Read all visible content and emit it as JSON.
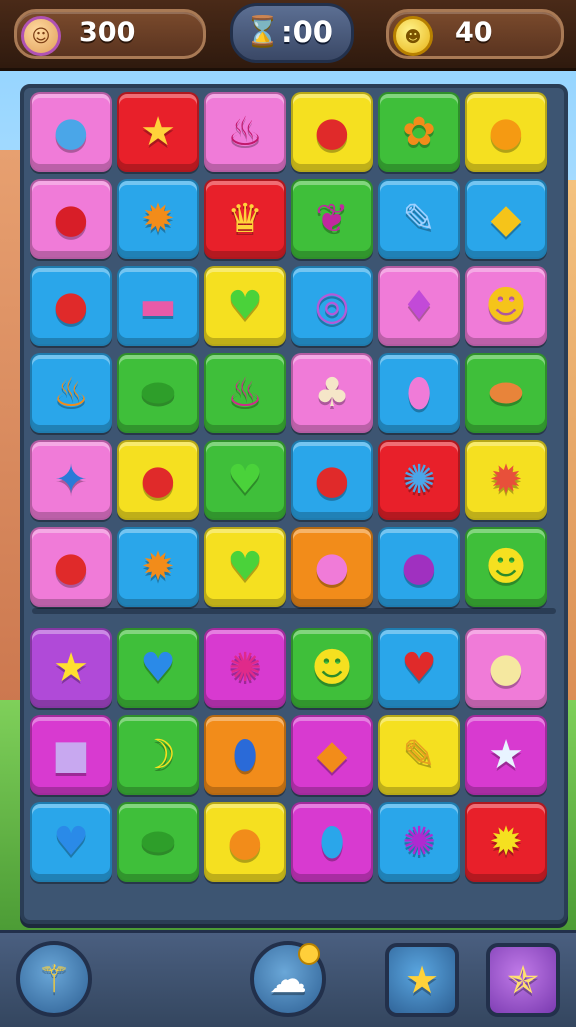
{
  "hud": {
    "score": "300",
    "timer": ":00",
    "coins": "40",
    "avatar_icon": "☺",
    "coin_icon": "☻",
    "timer_icon": "⌛"
  },
  "board": {
    "columns": 6,
    "rows": 9,
    "tiles": [
      {
        "color": "#f07bd8",
        "glyph": "●",
        "glyph_color": "#4aa6e8",
        "name": "blue-candy"
      },
      {
        "color": "#e8202a",
        "glyph": "★",
        "glyph_color": "#ffd23a",
        "name": "star-face"
      },
      {
        "color": "#f07bd8",
        "glyph": "♨",
        "glyph_color": "#c2186b",
        "name": "cupcake"
      },
      {
        "color": "#f5e020",
        "glyph": "●",
        "glyph_color": "#e02a2a",
        "name": "apple"
      },
      {
        "color": "#3fbf3a",
        "glyph": "✿",
        "glyph_color": "#f28c1a",
        "name": "flower"
      },
      {
        "color": "#f5e020",
        "glyph": "●",
        "glyph_color": "#f59a12",
        "name": "orange"
      },
      {
        "color": "#f07bd8",
        "glyph": "●",
        "glyph_color": "#d81e28",
        "name": "apple"
      },
      {
        "color": "#2aa6ea",
        "glyph": "✹",
        "glyph_color": "#f28c1a",
        "name": "sun-face"
      },
      {
        "color": "#e8202a",
        "glyph": "♛",
        "glyph_color": "#ffd23a",
        "name": "crown-candy"
      },
      {
        "color": "#3fbf3a",
        "glyph": "❦",
        "glyph_color": "#c0289e",
        "name": "grapes"
      },
      {
        "color": "#2aa6ea",
        "glyph": "✎",
        "glyph_color": "#9ed0ff",
        "name": "feather"
      },
      {
        "color": "#2aa6ea",
        "glyph": "◆",
        "glyph_color": "#f5c41a",
        "name": "pear"
      },
      {
        "color": "#2aa6ea",
        "glyph": "●",
        "glyph_color": "#e02a2a",
        "name": "apple"
      },
      {
        "color": "#2aa6ea",
        "glyph": "▬",
        "glyph_color": "#e85aa8",
        "name": "candy-stick"
      },
      {
        "color": "#f5e020",
        "glyph": "♥",
        "glyph_color": "#4ad23a",
        "name": "heart"
      },
      {
        "color": "#2aa6ea",
        "glyph": "◎",
        "glyph_color": "#b45ad8",
        "name": "donut"
      },
      {
        "color": "#f07bd8",
        "glyph": "♦",
        "glyph_color": "#c24ad8",
        "name": "leaf-candy"
      },
      {
        "color": "#f07bd8",
        "glyph": "☻",
        "glyph_color": "#f5c41a",
        "name": "lemon-face"
      },
      {
        "color": "#2aa6ea",
        "glyph": "♨",
        "glyph_color": "#f28c1a",
        "name": "carrot"
      },
      {
        "color": "#3fbf3a",
        "glyph": "⬬",
        "glyph_color": "#2e9e2a",
        "name": "pea-pod"
      },
      {
        "color": "#3fbf3a",
        "glyph": "♨",
        "glyph_color": "#d02a8a",
        "name": "pudding"
      },
      {
        "color": "#f07bd8",
        "glyph": "♣",
        "glyph_color": "#f5e6c8",
        "name": "acorn"
      },
      {
        "color": "#2aa6ea",
        "glyph": "⬮",
        "glyph_color": "#f07bd8",
        "name": "pink-blob"
      },
      {
        "color": "#3fbf3a",
        "glyph": "⬬",
        "glyph_color": "#e8843a",
        "name": "pie"
      },
      {
        "color": "#f07bd8",
        "glyph": "✦",
        "glyph_color": "#2a7ad8",
        "name": "blue-flower"
      },
      {
        "color": "#f5e020",
        "glyph": "●",
        "glyph_color": "#e02a2a",
        "name": "tomato"
      },
      {
        "color": "#3fbf3a",
        "glyph": "♥",
        "glyph_color": "#4ad23a",
        "name": "heart"
      },
      {
        "color": "#2aa6ea",
        "glyph": "●",
        "glyph_color": "#e02a2a",
        "name": "apple"
      },
      {
        "color": "#e8202a",
        "glyph": "✺",
        "glyph_color": "#4aa6e8",
        "name": "germ"
      },
      {
        "color": "#f5e020",
        "glyph": "✹",
        "glyph_color": "#e8503a",
        "name": "spiky-fruit"
      },
      {
        "color": "#f07bd8",
        "glyph": "●",
        "glyph_color": "#e02a2a",
        "name": "strawberry"
      },
      {
        "color": "#2aa6ea",
        "glyph": "✹",
        "glyph_color": "#f28c1a",
        "name": "sun-face"
      },
      {
        "color": "#f5e020",
        "glyph": "♥",
        "glyph_color": "#4ad23a",
        "name": "heart"
      },
      {
        "color": "#f28c1a",
        "glyph": "●",
        "glyph_color": "#f07bd8",
        "name": "bubble"
      },
      {
        "color": "#2aa6ea",
        "glyph": "●",
        "glyph_color": "#a030c0",
        "name": "plum"
      },
      {
        "color": "#3fbf3a",
        "glyph": "☻",
        "glyph_color": "#f5e020",
        "name": "lemon-face"
      },
      {
        "color": "#b04ad8",
        "glyph": "★",
        "glyph_color": "#ffe030",
        "name": "star-face"
      },
      {
        "color": "#3fbf3a",
        "glyph": "♥",
        "glyph_color": "#2a8ae8",
        "name": "heart"
      },
      {
        "color": "#d83ad0",
        "glyph": "✺",
        "glyph_color": "#e02a8a",
        "name": "germ"
      },
      {
        "color": "#3fbf3a",
        "glyph": "☻",
        "glyph_color": "#f5e020",
        "name": "lemon-face"
      },
      {
        "color": "#2aa6ea",
        "glyph": "♥",
        "glyph_color": "#e02a2a",
        "name": "apple-heart"
      },
      {
        "color": "#f07bd8",
        "glyph": "●",
        "glyph_color": "#f5e8a0",
        "name": "cream-ball"
      },
      {
        "color": "#d83ad0",
        "glyph": "■",
        "glyph_color": "#c8a8f0",
        "name": "cat-block"
      },
      {
        "color": "#3fbf3a",
        "glyph": "☽",
        "glyph_color": "#f5e020",
        "name": "banana"
      },
      {
        "color": "#f28c1a",
        "glyph": "⬮",
        "glyph_color": "#2a6ad8",
        "name": "bean"
      },
      {
        "color": "#d83ad0",
        "glyph": "◆",
        "glyph_color": "#f28c1a",
        "name": "carrot"
      },
      {
        "color": "#f5e020",
        "glyph": "✎",
        "glyph_color": "#e8a020",
        "name": "bird"
      },
      {
        "color": "#d83ad0",
        "glyph": "★",
        "glyph_color": "#e8f4ff",
        "name": "white-star"
      },
      {
        "color": "#2aa6ea",
        "glyph": "♥",
        "glyph_color": "#2a8ae8",
        "name": "heart"
      },
      {
        "color": "#3fbf3a",
        "glyph": "⬬",
        "glyph_color": "#2e9e2a",
        "name": "pickle"
      },
      {
        "color": "#f5e020",
        "glyph": "●",
        "glyph_color": "#f28c1a",
        "name": "mango"
      },
      {
        "color": "#d83ad0",
        "glyph": "⬮",
        "glyph_color": "#2aa6ea",
        "name": "feather"
      },
      {
        "color": "#2aa6ea",
        "glyph": "✺",
        "glyph_color": "#b02ad0",
        "name": "germ"
      },
      {
        "color": "#e8202a",
        "glyph": "✹",
        "glyph_color": "#f5e020",
        "name": "sun-face"
      }
    ]
  },
  "bottombar": {
    "magic_wand_icon": "⚚",
    "hint_icon": "☁",
    "star_icon": "★",
    "special_star_icon": "✯"
  }
}
